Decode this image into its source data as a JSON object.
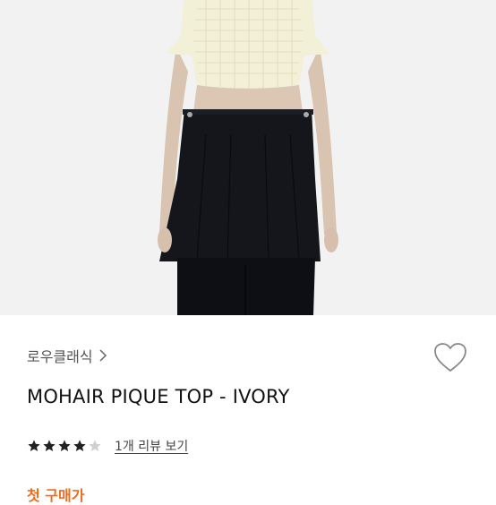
{
  "product": {
    "brand_label": "로우클래식",
    "title": "MOHAIR PIQUE TOP - IVORY",
    "rating": 4,
    "rating_max": 5,
    "review_link": "1개 리뷰 보기",
    "price_label_partial": "첫 구매가"
  },
  "icons": {
    "brand_chevron": "chevron-right-icon",
    "wishlist": "heart-outline-icon",
    "star_filled": "star-filled-icon",
    "star_empty": "star-empty-icon"
  },
  "colors": {
    "accent": "#f26b1d",
    "star": "#222222",
    "star_empty": "#d0d0d0",
    "photo_bg": "#f2f2f2"
  }
}
